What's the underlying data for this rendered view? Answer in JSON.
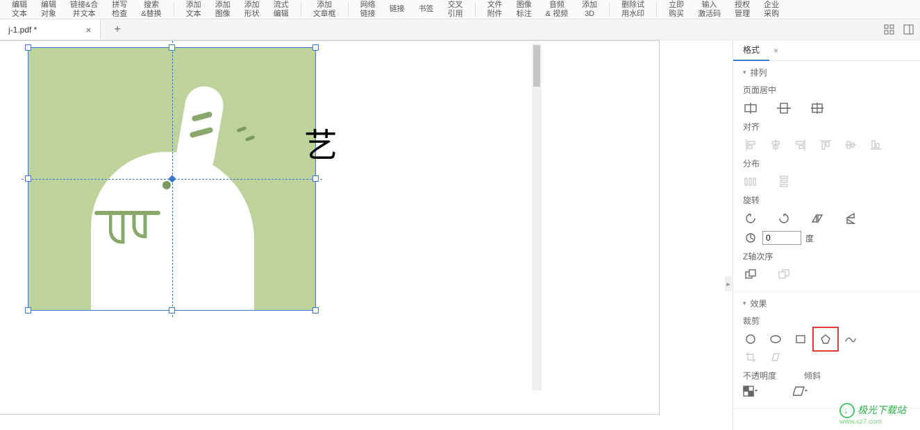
{
  "ribbon": [
    {
      "l1": "编辑",
      "l2": "文本"
    },
    {
      "l1": "编辑",
      "l2": "对象"
    },
    {
      "l1": "链接&合",
      "l2": "并文本"
    },
    {
      "l1": "拼写",
      "l2": "检查"
    },
    {
      "l1": "搜索",
      "l2": "&替换"
    },
    {
      "l1": "添加",
      "l2": "文本"
    },
    {
      "l1": "添加",
      "l2": "图像"
    },
    {
      "l1": "添加",
      "l2": "形状"
    },
    {
      "l1": "流式",
      "l2": "编辑"
    },
    {
      "l1": "添加",
      "l2": "文章框"
    },
    {
      "l1": "网络",
      "l2": "链接"
    },
    {
      "l1": "链接",
      "l2": ""
    },
    {
      "l1": "书签",
      "l2": ""
    },
    {
      "l1": "交叉",
      "l2": "引用"
    },
    {
      "l1": "文件",
      "l2": "附件"
    },
    {
      "l1": "图像",
      "l2": "标注"
    },
    {
      "l1": "音频",
      "l2": "& 视频"
    },
    {
      "l1": "添加",
      "l2": "3D"
    },
    {
      "l1": "删除试",
      "l2": "用水印"
    },
    {
      "l1": "立即",
      "l2": "购买"
    },
    {
      "l1": "输入",
      "l2": "激活码"
    },
    {
      "l1": "授权",
      "l2": "管理"
    },
    {
      "l1": "企业",
      "l2": "采购"
    }
  ],
  "tab": {
    "filename": "j-1.pdf *"
  },
  "letter": "艺",
  "side": {
    "tab_label": "格式",
    "arrange_label": "排列",
    "page_center": "页面居中",
    "align": "对齐",
    "distribute": "分布",
    "rotate": "旋转",
    "rotate_value": "0",
    "rotate_unit": "度",
    "zorder": "Z轴次序",
    "effects": "效果",
    "crop": "裁剪",
    "opacity": "不透明度",
    "skew": "倾斜"
  },
  "watermark": {
    "brand": "极光下载站",
    "url": "www.xz7.com"
  }
}
